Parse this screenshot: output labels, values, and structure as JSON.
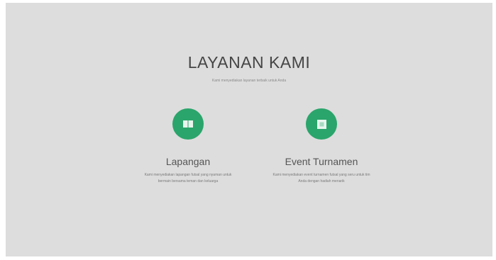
{
  "section": {
    "title": "LAYANAN KAMI",
    "subtitle": "Kami menyediakan layanan terbaik untuk Anda"
  },
  "services": [
    {
      "title": "Lapangan",
      "description": "Kami menyediakan lapangan futsal yang nyaman untuk bermain bersama teman dan keluarga",
      "icon": "book-icon"
    },
    {
      "title": "Event Turnamen",
      "description": "Kami menyediakan event turnamen futsal yang seru untuk tim Anda dengan hadiah menarik",
      "icon": "square-icon"
    }
  ],
  "colors": {
    "background": "#dddddd",
    "accent": "#2aa56b",
    "title": "#454545"
  }
}
